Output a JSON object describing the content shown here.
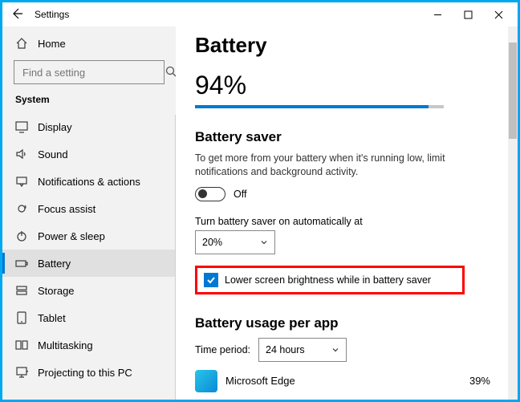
{
  "window": {
    "title": "Settings"
  },
  "sidebar": {
    "home_label": "Home",
    "search_placeholder": "Find a setting",
    "section_label": "System",
    "items": [
      {
        "label": "Display",
        "icon": "display-icon",
        "selected": false
      },
      {
        "label": "Sound",
        "icon": "sound-icon",
        "selected": false
      },
      {
        "label": "Notifications & actions",
        "icon": "notifications-icon",
        "selected": false
      },
      {
        "label": "Focus assist",
        "icon": "focus-icon",
        "selected": false
      },
      {
        "label": "Power & sleep",
        "icon": "power-icon",
        "selected": false
      },
      {
        "label": "Battery",
        "icon": "battery-icon",
        "selected": true
      },
      {
        "label": "Storage",
        "icon": "storage-icon",
        "selected": false
      },
      {
        "label": "Tablet",
        "icon": "tablet-icon",
        "selected": false
      },
      {
        "label": "Multitasking",
        "icon": "multitasking-icon",
        "selected": false
      },
      {
        "label": "Projecting to this PC",
        "icon": "projecting-icon",
        "selected": false
      }
    ]
  },
  "main": {
    "title": "Battery",
    "percentage": "94%",
    "progress_pct": 94,
    "saver_heading": "Battery saver",
    "saver_desc": "To get more from your battery when it's running low, limit notifications and background activity.",
    "toggle_state": "Off",
    "auto_label": "Turn battery saver on automatically at",
    "auto_value": "20%",
    "brightness_label": "Lower screen brightness while in battery saver",
    "brightness_checked": true,
    "usage_heading": "Battery usage per app",
    "time_period_label": "Time period:",
    "time_period_value": "24 hours",
    "apps": [
      {
        "name": "Microsoft Edge",
        "pct": "39%"
      }
    ]
  }
}
